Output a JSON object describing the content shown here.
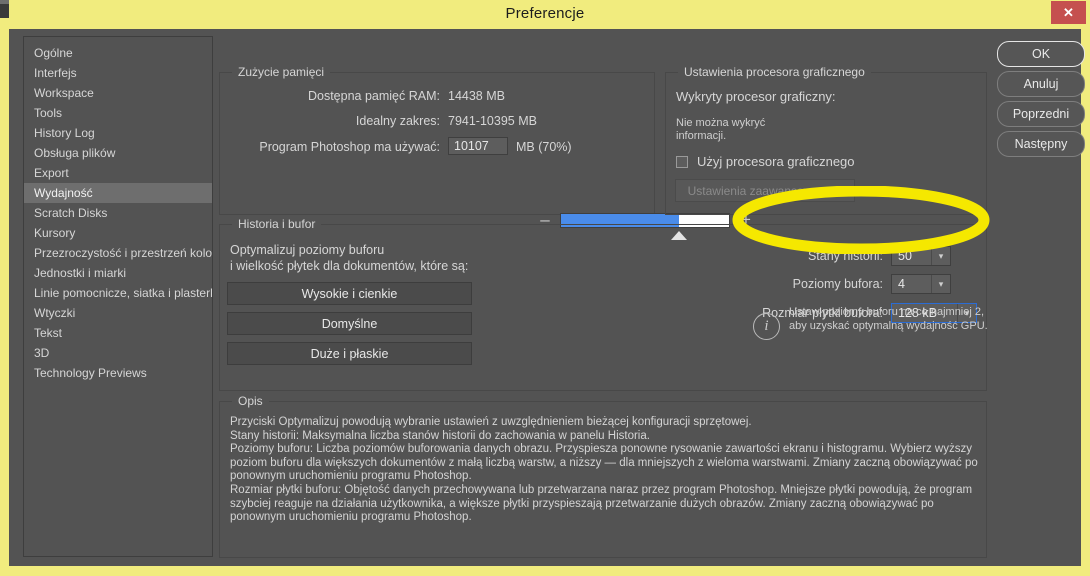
{
  "window": {
    "title": "Preferencje",
    "close_label": "✕",
    "frame_color": "#f1ec7e",
    "close_color": "#c5504f",
    "background": "#535353"
  },
  "sidebar": {
    "items": [
      {
        "label": "Ogólne",
        "selected": false
      },
      {
        "label": "Interfejs",
        "selected": false
      },
      {
        "label": "Workspace",
        "selected": false
      },
      {
        "label": "Tools",
        "selected": false
      },
      {
        "label": "History Log",
        "selected": false
      },
      {
        "label": "Obsługa plików",
        "selected": false
      },
      {
        "label": "Export",
        "selected": false
      },
      {
        "label": "Wydajność",
        "selected": true
      },
      {
        "label": "Scratch Disks",
        "selected": false
      },
      {
        "label": "Kursory",
        "selected": false
      },
      {
        "label": "Przezroczystość i przestrzeń kolorów",
        "selected": false
      },
      {
        "label": "Jednostki i miarki",
        "selected": false
      },
      {
        "label": "Linie pomocnicze, siatka i plasterki",
        "selected": false
      },
      {
        "label": "Wtyczki",
        "selected": false
      },
      {
        "label": "Tekst",
        "selected": false
      },
      {
        "label": "3D",
        "selected": false
      },
      {
        "label": "Technology Previews",
        "selected": false
      }
    ]
  },
  "memory": {
    "group_title": "Zużycie pamięci",
    "available_label": "Dostępna pamięć RAM:",
    "available_value": "14438 MB",
    "ideal_label": "Idealny zakres:",
    "ideal_value": "7941-10395 MB",
    "use_label": "Program Photoshop ma używać:",
    "use_value": "10107",
    "use_suffix": "MB (70%)",
    "slider_percent": 70,
    "minus_label": "–",
    "plus_label": "+",
    "fill_color": "#4a8cea"
  },
  "gpu": {
    "group_title": "Ustawienia procesora graficznego",
    "detected_label": "Wykryty procesor graficzny:",
    "detected_value_line1": "Nie można wykryć",
    "detected_value_line2": "informacji.",
    "use_gpu_label": "Użyj procesora graficznego",
    "use_gpu_checked": false,
    "advanced_button": "Ustawienia zaawansowane..."
  },
  "history": {
    "group_title": "Historia i bufor",
    "optimize_line1": "Optymalizuj poziomy buforu",
    "optimize_line2": "i wielkość płytek dla dokumentów, które są:",
    "buttons": [
      "Wysokie i cienkie",
      "Domyślne",
      "Duże i płaskie"
    ],
    "history_states_label": "Stany historii:",
    "history_states_value": "50",
    "cache_levels_label": "Poziomy bufora:",
    "cache_levels_value": "4",
    "tile_size_label": "Rozmiar płytki bufora:",
    "tile_size_value": "128 kB",
    "info_icon": "i",
    "info_text": "Ustaw poziomy buforu na co najmniej 2, aby uzyskać optymalną wydajność GPU."
  },
  "description": {
    "group_title": "Opis",
    "paragraphs": [
      "Przyciski Optymalizuj powodują wybranie ustawień z uwzględnieniem bieżącej konfiguracji sprzętowej.",
      "Stany historii: Maksymalna liczba stanów historii do zachowania w panelu Historia.",
      "Poziomy buforu: Liczba poziomów buforowania danych obrazu. Przyspiesza ponowne rysowanie zawartości ekranu i histogramu. Wybierz wyższy poziom buforu dla większych dokumentów z małą liczbą warstw, a niższy — dla mniejszych z wieloma warstwami. Zmiany zaczną obowiązywać po ponownym uruchomieniu programu Photoshop.",
      "Rozmiar płytki buforu: Objętość danych przechowywana lub przetwarzana naraz przez program Photoshop. Mniejsze płytki powodują, że program szybciej reaguje na działania użytkownika, a większe płytki przyspieszają przetwarzanie dużych obrazów. Zmiany zaczną obowiązywać po ponownym uruchomieniu programu Photoshop."
    ]
  },
  "actions": {
    "buttons": [
      {
        "label": "OK",
        "default": true
      },
      {
        "label": "Anuluj",
        "default": false
      },
      {
        "label": "Poprzedni",
        "default": false
      },
      {
        "label": "Następny",
        "default": false
      }
    ]
  },
  "annotation": {
    "shape": "ellipse",
    "color": "#f5e800",
    "target": "Stany historii: 50"
  }
}
